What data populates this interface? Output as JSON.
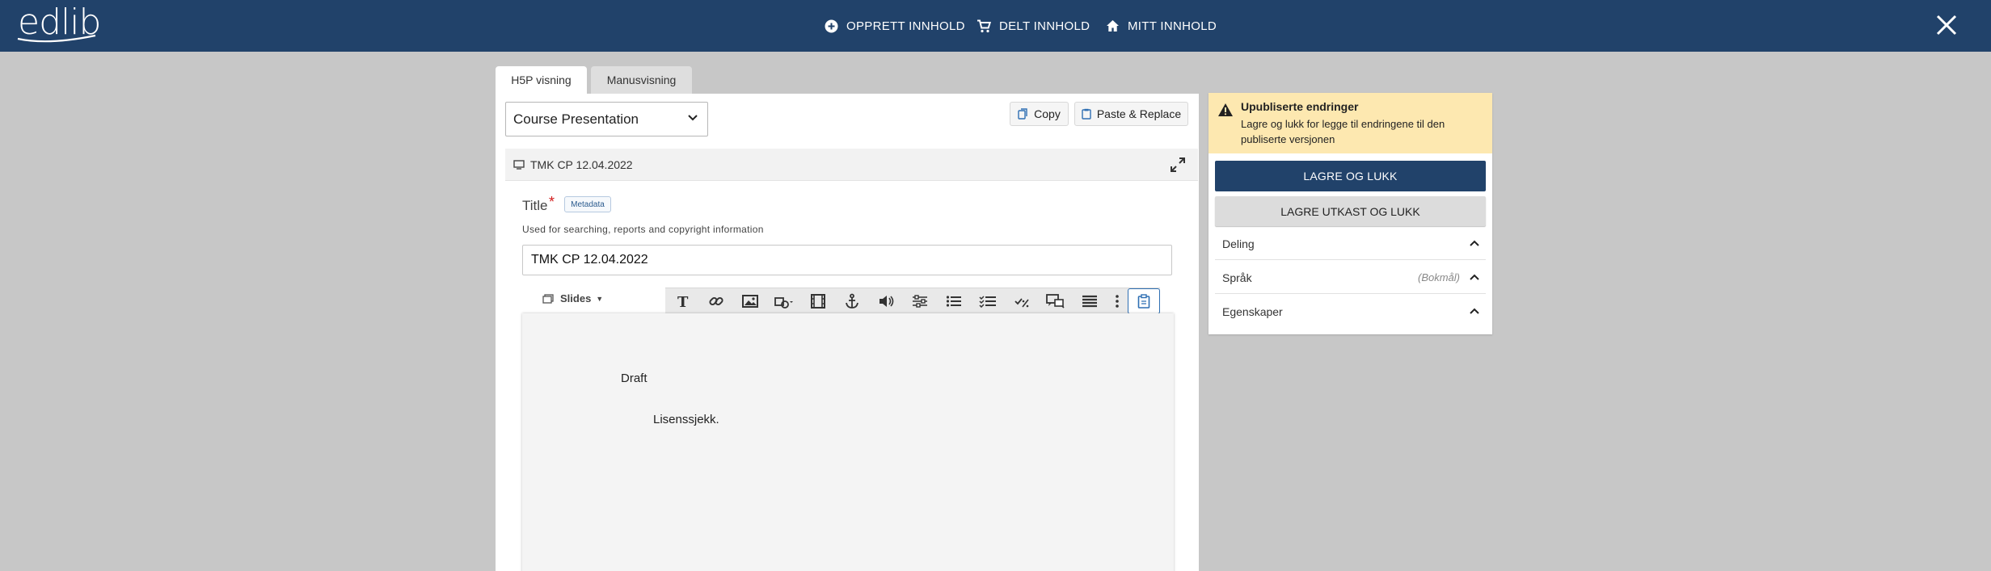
{
  "header": {
    "logo_text": "edlib",
    "nav": {
      "create": "OPPRETT INNHOLD",
      "shared": "DELT INNHOLD",
      "mine": "MITT INNHOLD"
    },
    "bg_color": "#21426a"
  },
  "tabs": [
    {
      "label": "H5P visning",
      "active": true
    },
    {
      "label": "Manusvisning",
      "active": false
    }
  ],
  "editor": {
    "content_type": "Course Presentation",
    "copy_label": "Copy",
    "paste_label": "Paste & Replace",
    "section_title": "TMK CP 12.04.2022",
    "title_label": "Title",
    "required_mark": "*",
    "metadata_label": "Metadata",
    "title_description": "Used for searching, reports and copyright information",
    "title_value": "TMK CP 12.04.2022",
    "slides_label": "Slides",
    "toolbar_icons": [
      "text-icon",
      "link-icon",
      "image-icon",
      "shapes-icon",
      "video-icon",
      "anchor-icon",
      "audio-icon",
      "interactions-icon",
      "list-icon",
      "checklist-icon",
      "percent-icon",
      "dialog-icon",
      "table-list-icon",
      "more-icon",
      "paste-icon"
    ],
    "slide_text": {
      "draft": "Draft",
      "lisens": "Lisenssjekk."
    }
  },
  "sidebar": {
    "warning_title": "Upubliserte endringer",
    "warning_text": "Lagre og lukk for legge til endringene til den publiserte versjonen",
    "save_close": "LAGRE OG LUKK",
    "save_draft_close": "LAGRE UTKAST OG LUKK",
    "sections": {
      "deling": "Deling",
      "sprak": "Språk",
      "sprak_value": "(Bokmål)",
      "egenskaper": "Egenskaper"
    },
    "warning_color": "#fde8b0",
    "primary_color": "#21426a"
  }
}
